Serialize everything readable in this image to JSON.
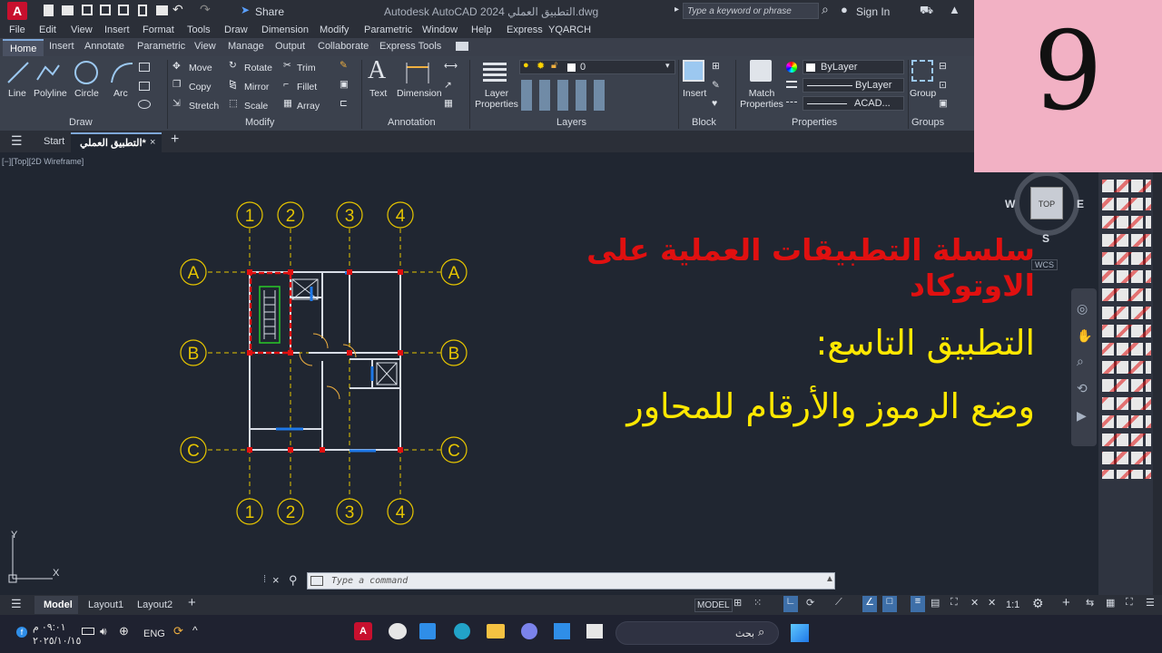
{
  "titlebar": {
    "app_logo": "A",
    "share_label": "Share",
    "title": "Autodesk AutoCAD 2024   التطبيق العملي.dwg",
    "search_placeholder": "Type a keyword or phrase",
    "sign_in": "Sign In"
  },
  "menu": [
    "File",
    "Edit",
    "View",
    "Insert",
    "Format",
    "Tools",
    "Draw",
    "Dimension",
    "Modify",
    "Parametric",
    "Window",
    "Help",
    "Express",
    "YQARCH"
  ],
  "ribbon_tabs": [
    "Home",
    "Insert",
    "Annotate",
    "Parametric",
    "View",
    "Manage",
    "Output",
    "Collaborate",
    "Express Tools"
  ],
  "ribbon": {
    "draw": {
      "title": "Draw",
      "line": "Line",
      "polyline": "Polyline",
      "circle": "Circle",
      "arc": "Arc"
    },
    "modify": {
      "title": "Modify",
      "move": "Move",
      "rotate": "Rotate",
      "trim": "Trim",
      "copy": "Copy",
      "mirror": "Mirror",
      "fillet": "Fillet",
      "stretch": "Stretch",
      "scale": "Scale",
      "array": "Array"
    },
    "annotation": {
      "title": "Annotation",
      "text": "Text",
      "dimension": "Dimension"
    },
    "layers": {
      "title": "Layers",
      "layer_properties": "Layer Properties",
      "current_layer": "0"
    },
    "block": {
      "title": "Block",
      "insert": "Insert"
    },
    "properties": {
      "title": "Properties",
      "match": "Match Properties",
      "color": "ByLayer",
      "linetype": "ByLayer",
      "lineweight": "ACAD..."
    },
    "groups": {
      "title": "Groups",
      "group": "Group"
    }
  },
  "doctabs": {
    "start": "Start",
    "file": "التطبيق العملي*"
  },
  "viewport_label": "[−][Top][2D Wireframe]",
  "viewcube": {
    "top": "TOP",
    "n": "N",
    "s": "S",
    "e": "E",
    "w": "W",
    "wcs": "WCS"
  },
  "drawing": {
    "col_labels": [
      "1",
      "2",
      "3",
      "4"
    ],
    "row_labels": [
      "A",
      "B",
      "C"
    ],
    "title_red": "سلسلة التطبيقات العملية على الاوتوكاد",
    "line1": "التطبيق التاسع:",
    "line2": "وضع الرموز والأرقام للمحاور"
  },
  "ucs": {
    "x": "X",
    "y": "Y"
  },
  "command_placeholder": "Type a command",
  "status": {
    "model_tab": "Model",
    "layout1": "Layout1",
    "layout2": "Layout2",
    "model_btn": "MODEL",
    "scale": "1:1"
  },
  "taskbar": {
    "time": "٠٩:٠١ م",
    "date": "٢٠٢٥/١٠/١٥",
    "lang": "ENG",
    "search": "بحث"
  },
  "thumbnail_number": "9",
  "colors": {
    "accent": "#e6c500",
    "title_red": "#e01010",
    "text_yellow": "#ffe800",
    "thumb_bg": "#f2b1c4"
  }
}
